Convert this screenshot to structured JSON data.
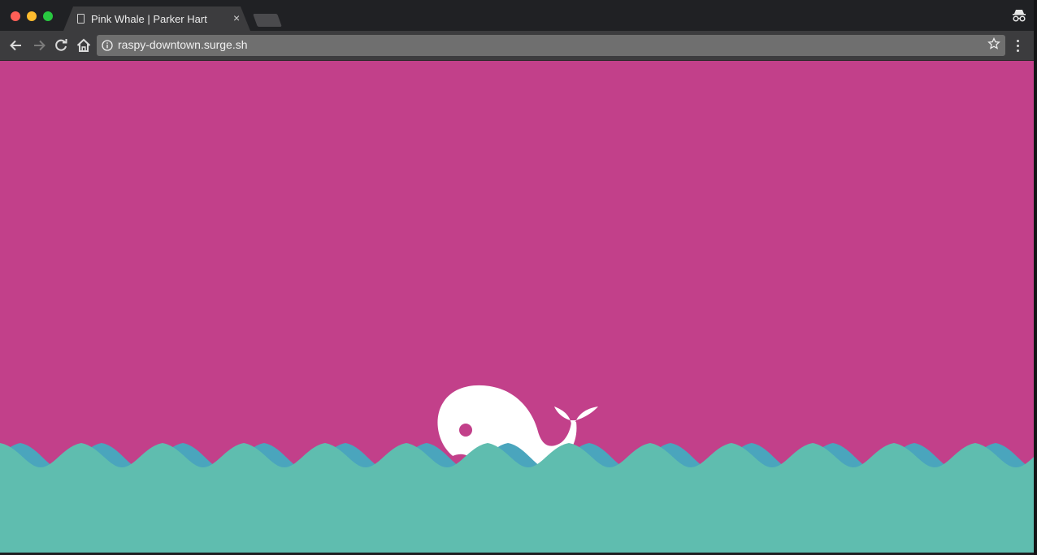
{
  "browser": {
    "tab_title": "Pink Whale | Parker Hart",
    "tab_close": "×",
    "url": "raspy-downtown.surge.sh",
    "icons": {
      "tab": "document-icon",
      "back": "arrow-left-icon",
      "forward": "arrow-right-icon",
      "reload": "reload-icon",
      "home": "home-icon",
      "info": "info-icon",
      "bookmark": "star-icon",
      "menu": "kebab-menu-icon",
      "profile": "incognito-icon"
    }
  },
  "page": {
    "background_color": "#c2408a",
    "wave_back_color": "#4aa5bd",
    "wave_front_color": "#5fbdaf",
    "whale_color": "#ffffff"
  }
}
